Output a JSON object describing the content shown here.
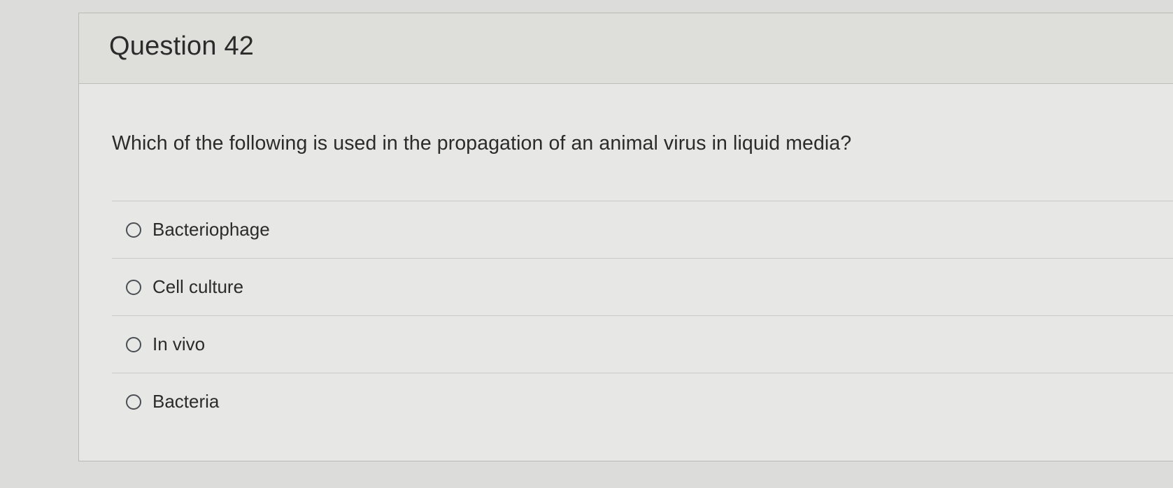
{
  "question": {
    "title": "Question 42",
    "text": "Which of the following is used in the propagation of an animal virus in liquid media?",
    "answers": [
      {
        "label": "Bacteriophage",
        "selected": false
      },
      {
        "label": "Cell culture",
        "selected": false
      },
      {
        "label": "In vivo",
        "selected": false
      },
      {
        "label": "Bacteria",
        "selected": false
      }
    ]
  }
}
